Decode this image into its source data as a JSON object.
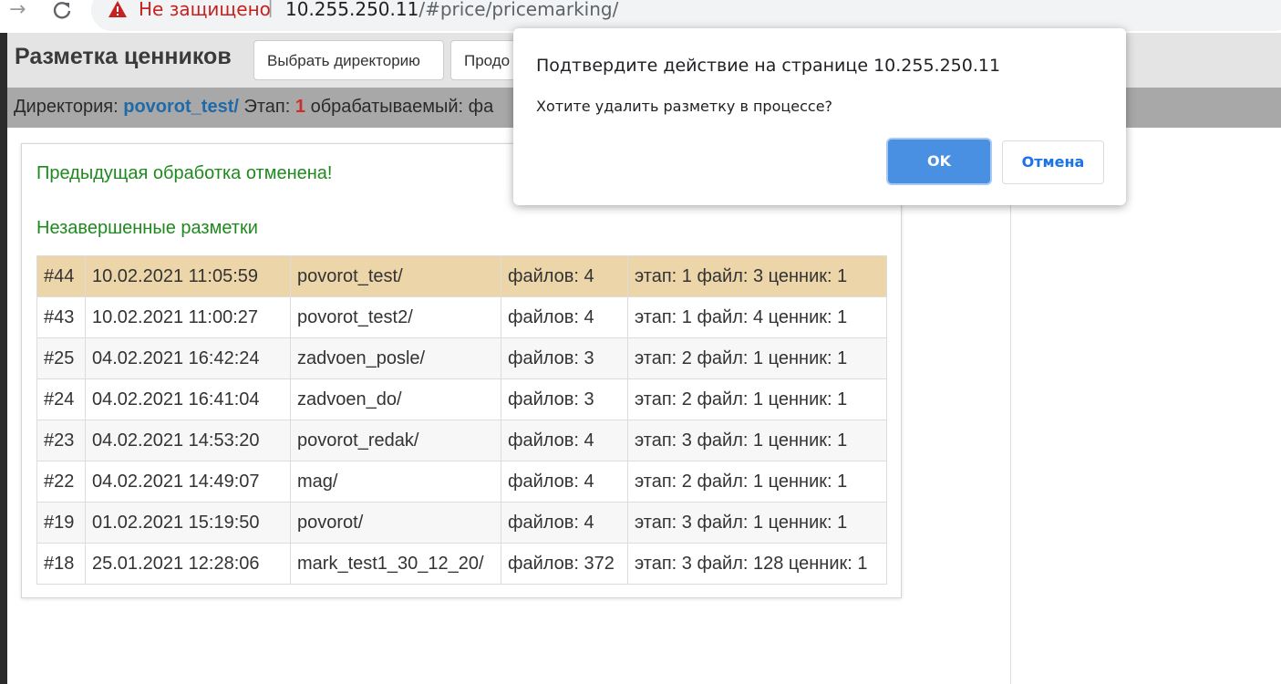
{
  "browser": {
    "back_icon": "arrow-right-icon",
    "reload_icon": "reload-icon",
    "security_label": "Не защищено",
    "separator": "|",
    "url_host": "10.255.250.11",
    "url_path": "/#price/pricemarking/"
  },
  "header": {
    "title": "Разметка ценников",
    "select_dir_button": "Выбрать директорию",
    "continue_button": "Продо"
  },
  "status": {
    "dir_label": "Директория:",
    "dir_value": "povorot_test/",
    "stage_label": "Этап:",
    "stage_value": "1",
    "processing_label": "обрабатываемый: фа"
  },
  "panel": {
    "cancelled_message": "Предыдущая обработка отменена!",
    "unfinished_heading": "Незавершенные разметки",
    "rows": [
      {
        "id": "#44",
        "date": "10.02.2021 11:05:59",
        "dir": "povorot_test/",
        "files": "файлов: 4",
        "progress": "этап: 1 файл: 3 ценник: 1"
      },
      {
        "id": "#43",
        "date": "10.02.2021 11:00:27",
        "dir": "povorot_test2/",
        "files": "файлов: 4",
        "progress": "этап: 1 файл: 4 ценник: 1"
      },
      {
        "id": "#25",
        "date": "04.02.2021 16:42:24",
        "dir": "zadvoen_posle/",
        "files": "файлов: 3",
        "progress": "этап: 2 файл: 1 ценник: 1"
      },
      {
        "id": "#24",
        "date": "04.02.2021 16:41:04",
        "dir": "zadvoen_do/",
        "files": "файлов: 3",
        "progress": "этап: 2 файл: 1 ценник: 1"
      },
      {
        "id": "#23",
        "date": "04.02.2021 14:53:20",
        "dir": "povorot_redak/",
        "files": "файлов: 4",
        "progress": "этап: 3 файл: 1 ценник: 1"
      },
      {
        "id": "#22",
        "date": "04.02.2021 14:49:07",
        "dir": "mag/",
        "files": "файлов: 4",
        "progress": "этап: 2 файл: 1 ценник: 1"
      },
      {
        "id": "#19",
        "date": "01.02.2021 15:19:50",
        "dir": "povorot/",
        "files": "файлов: 4",
        "progress": "этап: 3 файл: 1 ценник: 1"
      },
      {
        "id": "#18",
        "date": "25.01.2021 12:28:06",
        "dir": "mark_test1_30_12_20/",
        "files": "файлов: 372",
        "progress": "этап: 3 файл: 128 ценник: 1"
      }
    ]
  },
  "dialog": {
    "title": "Подтвердите действие на странице 10.255.250.11",
    "message": "Хотите удалить разметку в процессе?",
    "ok_button": "OK",
    "cancel_button": "Отмена"
  },
  "colors": {
    "active_row": "#ecd5a8",
    "success_text": "#1e8a1e",
    "dir_link": "#1f6aa8",
    "stage_number": "#c9302c",
    "ok_button": "#4a90e2"
  }
}
